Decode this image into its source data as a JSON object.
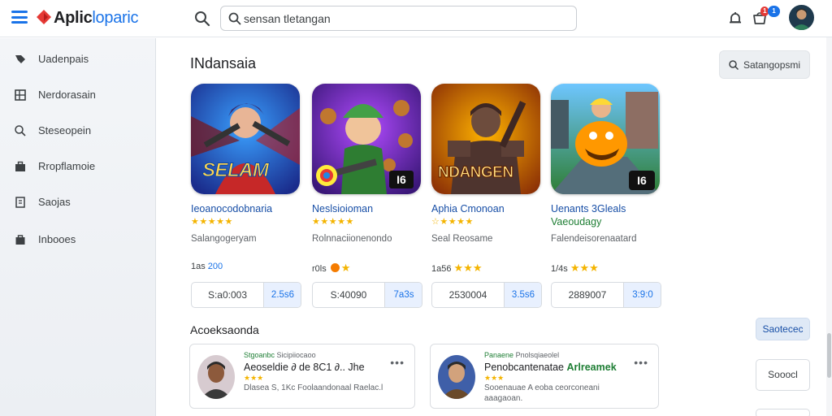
{
  "header": {
    "logo_text_a": "Aplic",
    "logo_text_b": "loparic",
    "search": {
      "value": "sensan tletangan",
      "placeholder": ""
    },
    "notification_count": "1",
    "message_count": "1"
  },
  "sidebar": {
    "items": [
      {
        "label": "Uadenpais",
        "icon": "tag-icon"
      },
      {
        "label": "Nerdorasain",
        "icon": "grid-icon"
      },
      {
        "label": "Steseopein",
        "icon": "search-people-icon"
      },
      {
        "label": "Rropflamoie",
        "icon": "briefcase-icon"
      },
      {
        "label": "Saojas",
        "icon": "document-icon"
      },
      {
        "label": "Inbooes",
        "icon": "bag-icon"
      }
    ]
  },
  "main": {
    "section_title": "INdansaia",
    "filter_button": "Satangopsmi",
    "apps": [
      {
        "title": "Ieoanocodobnaria",
        "stars": "★★★★★",
        "subtitle": "Salangogeryam",
        "meta_prefix": "1as ",
        "meta_value": "200",
        "price": "S:a0:003",
        "badge": "2.5s6",
        "thumb_text": "SELAM"
      },
      {
        "title": "Neslsioioman",
        "stars": "★★★★★",
        "subtitle": "Rolnnaciionenondo",
        "meta_prefix": "r0ls",
        "meta_value": "",
        "price": "S:40090",
        "badge": "7a3s",
        "thumb_text": "I6"
      },
      {
        "title": "Aphia Cmonoan",
        "stars": "☆★★★★",
        "subtitle": "Seal Reosame",
        "meta_prefix": "1a56",
        "meta_value": "",
        "price": "2530004",
        "badge": "3.5s6",
        "thumb_text": "NDANGEN"
      },
      {
        "title": "Uenants 3Gleals",
        "title2": "Vaeoudagy",
        "stars": "",
        "subtitle": "Falendeisorenaatard",
        "meta_prefix": "1/4s",
        "meta_value": "",
        "price": "2889007",
        "badge": "3:9:0",
        "thumb_text": "I6"
      }
    ],
    "sub_title": "Acoeksaonda",
    "see_button": "Saotecec",
    "side_button": "Sooocl",
    "list": [
      {
        "tag": "Stgoanbc",
        "tag_rest": "Sicipiiocaoo",
        "title": "Aeoseldie ∂ de 8C1 ∂.. Jhe",
        "title_accent": "",
        "stars": "★★★",
        "desc": "Dlasea S, 1Kc Foolaandonaal Raelac.l"
      },
      {
        "tag": "Panaene",
        "tag_rest": "Pnolsqiaeolel",
        "title": "Penobcantenatae",
        "title_accent": "Arlreamek",
        "stars": "★★★",
        "desc": "Sooenauae A eoba ceorconeani aaagaoan."
      }
    ]
  },
  "colors": {
    "accent": "#1a73e8",
    "star": "#f4b400",
    "green": "#1e7e34"
  }
}
